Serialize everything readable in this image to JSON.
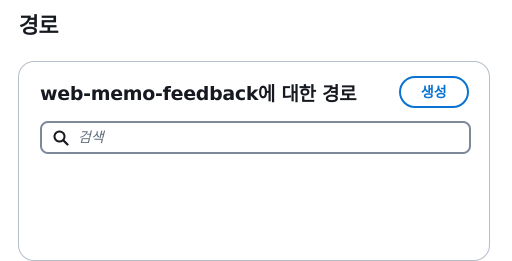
{
  "page": {
    "title": "경로"
  },
  "panel": {
    "title": "web-memo-feedback에 대한 경로",
    "create_label": "생성"
  },
  "search": {
    "placeholder": "검색",
    "value": ""
  },
  "colors": {
    "accent": "#0972d3",
    "border": "#b6bec9",
    "input_border": "#7d8998",
    "text": "#16191f"
  }
}
